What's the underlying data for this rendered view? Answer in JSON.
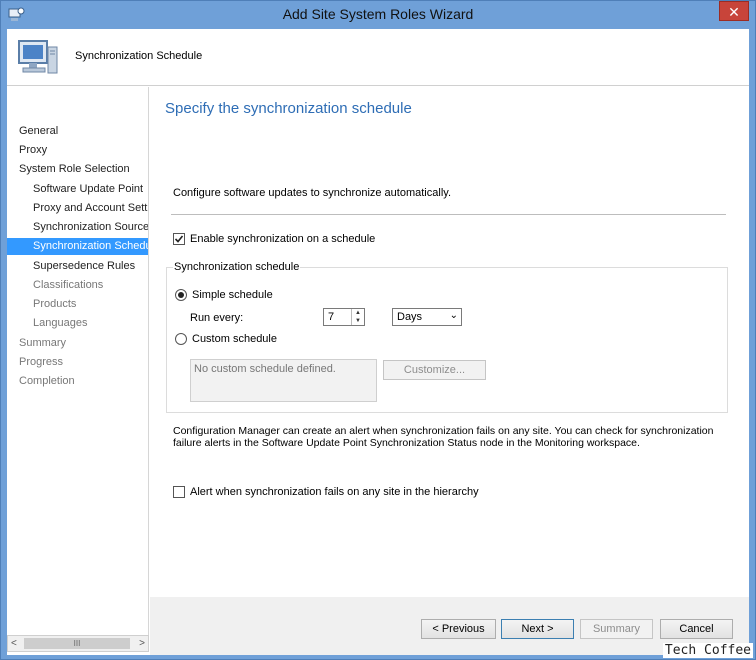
{
  "window": {
    "title": "Add Site System Roles Wizard",
    "close_glyph": "✕"
  },
  "header": {
    "title": "Synchronization Schedule"
  },
  "sidebar": {
    "items": [
      {
        "label": "General",
        "level": 0,
        "state": "done"
      },
      {
        "label": "Proxy",
        "level": 0,
        "state": "done"
      },
      {
        "label": "System Role Selection",
        "level": 0,
        "state": "done"
      },
      {
        "label": "Software Update Point",
        "level": 1,
        "state": "done"
      },
      {
        "label": "Proxy and Account Settings",
        "level": 1,
        "state": "done"
      },
      {
        "label": "Synchronization Source",
        "level": 1,
        "state": "done"
      },
      {
        "label": "Synchronization Schedule",
        "level": 1,
        "state": "selected"
      },
      {
        "label": "Supersedence Rules",
        "level": 1,
        "state": "done"
      },
      {
        "label": "Classifications",
        "level": 1,
        "state": "pending"
      },
      {
        "label": "Products",
        "level": 1,
        "state": "pending"
      },
      {
        "label": "Languages",
        "level": 1,
        "state": "pending"
      },
      {
        "label": "Summary",
        "level": 0,
        "state": "pending"
      },
      {
        "label": "Progress",
        "level": 0,
        "state": "pending"
      },
      {
        "label": "Completion",
        "level": 0,
        "state": "pending"
      }
    ],
    "scroll_thumb_label": "III",
    "scroll_left": "<",
    "scroll_right": ">"
  },
  "content": {
    "heading": "Specify the synchronization schedule",
    "intro": "Configure software updates to synchronize automatically.",
    "enable_label": "Enable synchronization on a schedule",
    "enable_checked": true,
    "group_label": "Synchronization schedule",
    "simple_label": "Simple schedule",
    "simple_selected": true,
    "run_every_label": "Run every:",
    "run_every_value": "7",
    "unit_value": "Days",
    "custom_label": "Custom schedule",
    "custom_placeholder": "No custom schedule defined.",
    "customize_button": "Customize...",
    "info_text": "Configuration Manager can create an alert when synchronization fails on any site. You can check for synchronization failure alerts in the Software Update Point Synchronization Status node in the Monitoring workspace.",
    "alert_label": "Alert when synchronization fails on any site in the hierarchy",
    "alert_checked": false
  },
  "footer": {
    "previous": "< Previous",
    "next": "Next >",
    "summary": "Summary",
    "cancel": "Cancel"
  },
  "watermark": "Tech Coffee",
  "colors": {
    "selection": "#3399ff",
    "heading": "#2e6db5",
    "titlebar": "#6fa0d8"
  }
}
